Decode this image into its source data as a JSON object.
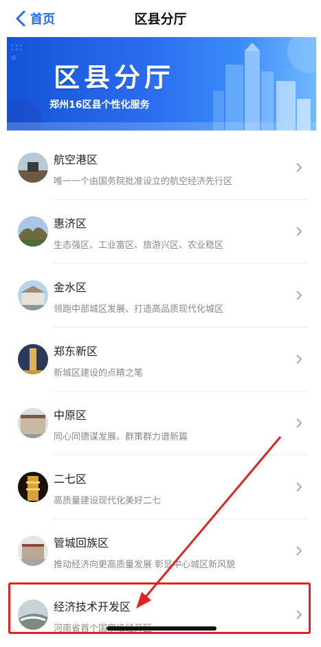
{
  "nav": {
    "back_label": "首页",
    "title": "区县分厅"
  },
  "banner": {
    "title": "区县分厅",
    "subtitle": "郑州16区县个性化服务"
  },
  "districts": [
    {
      "name": "航空港区",
      "desc": "唯一一个由国务院批准设立的航空经济先行区"
    },
    {
      "name": "惠济区",
      "desc": "生态强区、工业富区、旅游兴区、农业稳区"
    },
    {
      "name": "金水区",
      "desc": "领跑中部城区发展、打造高品质现代化城区"
    },
    {
      "name": "郑东新区",
      "desc": "新城区建设的点睛之笔"
    },
    {
      "name": "中原区",
      "desc": "同心同德谋发展、群策群力谱新篇"
    },
    {
      "name": "二七区",
      "desc": "高质量建设现代化美好二七"
    },
    {
      "name": "管城回族区",
      "desc": "推动经济向更高质量发展 彰显中心城区新风貌"
    },
    {
      "name": "经济技术开发区",
      "desc": "河南省首个国家级经开区"
    }
  ],
  "colors": {
    "accent": "#1a6ef2",
    "highlight": "#e22222"
  }
}
